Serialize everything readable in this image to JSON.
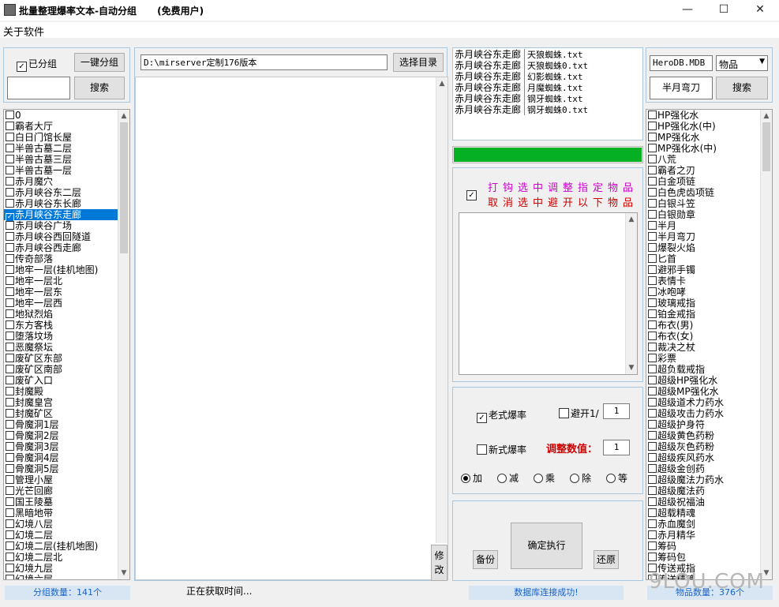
{
  "window": {
    "title": "批量整理爆率文本-自动分组",
    "edition": "(免费用户)",
    "minimize": "—",
    "maximize": "☐",
    "close": "✕"
  },
  "menu": {
    "about": "关于软件"
  },
  "group_panel": {
    "grouped_label": "已分组",
    "grouped_checked": true,
    "one_click_group": "一键分组",
    "search_value": "",
    "search_button": "搜索"
  },
  "group_list": {
    "items": [
      "0",
      "霸者大厅",
      "白日门馆长屋",
      "半兽古墓二层",
      "半兽古墓三层",
      "半兽古墓一层",
      "赤月魔穴",
      "赤月峡谷东二层",
      "赤月峡谷东长廊",
      "赤月峡谷东走廊",
      "赤月峡谷广场",
      "赤月峡谷西回隧道",
      "赤月峡谷西走廊",
      "传奇部落",
      "地牢一层(挂机地图)",
      "地牢一层北",
      "地牢一层东",
      "地牢一层西",
      "地狱烈焰",
      "东方客栈",
      "堕落坟场",
      "恶魔祭坛",
      "废矿区东部",
      "废矿区南部",
      "废矿入口",
      "封魔殿",
      "封魔皇宫",
      "封魔矿区",
      "骨魔洞1层",
      "骨魔洞2层",
      "骨魔洞3层",
      "骨魔洞4层",
      "骨魔洞5层",
      "管理小屋",
      "光芒回廊",
      "国王陵墓",
      "黑暗地带",
      "幻境八层",
      "幻境二层",
      "幻境二层(挂机地图)",
      "幻境二层北",
      "幻境九层",
      "幻境六层"
    ],
    "selected_index": 9,
    "count_label": "分组数量：141个"
  },
  "path": {
    "value": "D:\\mirserver定制176版本",
    "browse_button": "选择目录"
  },
  "editor": {
    "content": "",
    "modify_button_line1": "修",
    "modify_button_line2": "改"
  },
  "status_time": "正在获取时间...",
  "file_list": {
    "rows": [
      {
        "map": "赤月峡谷东走廊",
        "file": "天狼蜘蛛.txt"
      },
      {
        "map": "赤月峡谷东走廊",
        "file": "天狼蜘蛛0.txt"
      },
      {
        "map": "赤月峡谷东走廊",
        "file": "幻影蜘蛛.txt"
      },
      {
        "map": "赤月峡谷东走廊",
        "file": "月魔蜘蛛.txt"
      },
      {
        "map": "赤月峡谷东走廊",
        "file": "钢牙蜘蛛.txt"
      },
      {
        "map": "赤月峡谷东走廊",
        "file": "钢牙蜘蛛0.txt"
      }
    ]
  },
  "progress": {
    "value": 100,
    "color": "#06b025"
  },
  "adjust_items": {
    "checked": true,
    "line1": "打钩选中调整指定物品",
    "line2": "取消选中避开以下物品",
    "line1_color": "#cc00cc",
    "line2_color": "#cc0000",
    "content": ""
  },
  "rate_panel": {
    "old_style": "老式爆率",
    "old_checked": true,
    "new_style": "新式爆率",
    "new_checked": false,
    "avoid_label": "避开1/",
    "avoid_checked": false,
    "avoid_value": "1",
    "adjust_label": "调整数值：",
    "adjust_color": "#cc0000",
    "adjust_value": "1",
    "ops": [
      "加",
      "减",
      "乘",
      "除",
      "等"
    ],
    "selected_op": 0
  },
  "actions": {
    "backup": "备份",
    "execute": "确定执行",
    "restore": "还原"
  },
  "db_status": "数据库连接成功!",
  "db_panel": {
    "db_file": "HeroDB.MDB",
    "table": "物品",
    "search_value": "半月弯刀",
    "search_button": "搜索"
  },
  "item_list": {
    "items": [
      "HP强化水",
      "HP强化水(中)",
      "MP强化水",
      "MP强化水(中)",
      "八荒",
      "霸者之刃",
      "白金项链",
      "白色虎齿项链",
      "白银斗笠",
      "白银勋章",
      "半月",
      "半月弯刀",
      "爆裂火焰",
      "匕首",
      "避邪手镯",
      "表情卡",
      "冰咆哮",
      "玻璃戒指",
      "铂金戒指",
      "布衣(男)",
      "布衣(女)",
      "裁决之杖",
      "彩票",
      "超负载戒指",
      "超级HP强化水",
      "超级MP强化水",
      "超级道术力药水",
      "超级攻击力药水",
      "超级护身符",
      "超级黄色药粉",
      "超级灰色药粉",
      "超级疾风药水",
      "超级金创药",
      "超级魔法力药水",
      "超级魔法药",
      "超级祝福油",
      "超载精魂",
      "赤血魔剑",
      "赤月精华",
      "筹码",
      "筹码包",
      "传送戒指",
      "传送精魂"
    ],
    "count_label": "物品数量：376个"
  },
  "watermark": "9LOU.COM"
}
